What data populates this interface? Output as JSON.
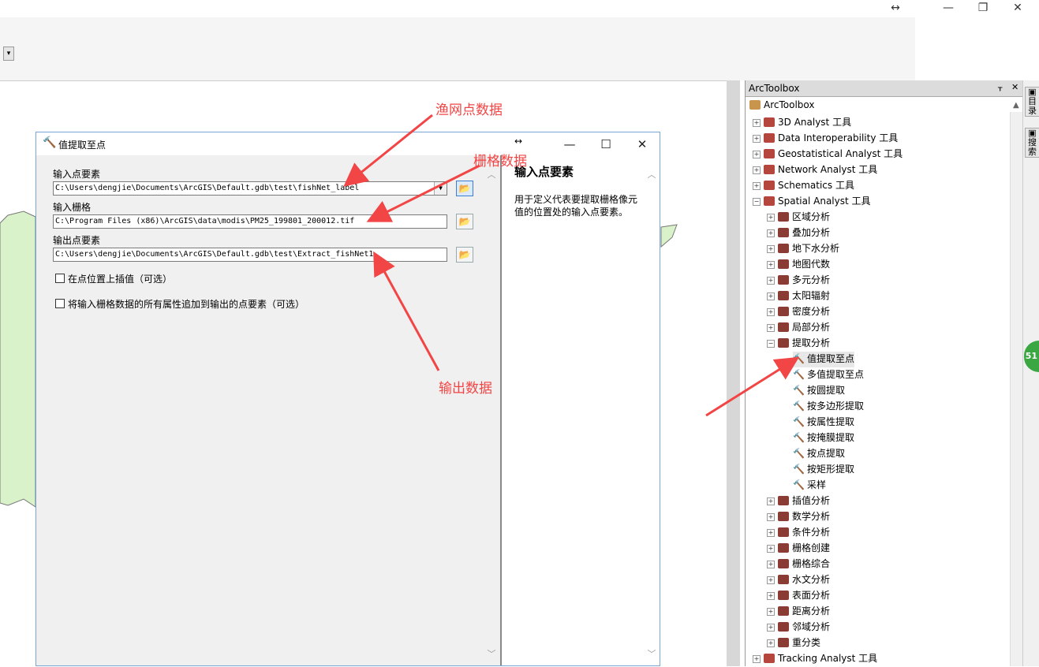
{
  "window": {
    "resize_icon": "↔",
    "minimize_icon": "—",
    "restore_icon": "❐",
    "close_icon": "✕"
  },
  "dialog": {
    "title": "值提取至点",
    "resize_icon": "↔",
    "minimize": "—",
    "maximize": "☐",
    "close": "✕",
    "fields": [
      {
        "label": "输入点要素",
        "value": "C:\\Users\\dengjie\\Documents\\ArcGIS\\Default.gdb\\test\\fishNet_label"
      },
      {
        "label": "输入栅格",
        "value": "C:\\Program Files (x86)\\ArcGIS\\data\\modis\\PM25_199801_200012.tif"
      },
      {
        "label": "输出点要素",
        "value": "C:\\Users\\dengjie\\Documents\\ArcGIS\\Default.gdb\\test\\Extract_fishNet1"
      }
    ],
    "checkboxes": [
      {
        "label": "在点位置上插值（可选）",
        "checked": false
      },
      {
        "label": "将输入栅格数据的所有属性追加到输出的点要素（可选）",
        "checked": false
      }
    ],
    "help": {
      "title": "输入点要素",
      "text": "用于定义代表要提取栅格像元值的位置处的输入点要素。"
    }
  },
  "annotations": {
    "fishnet": "渔网点数据",
    "raster": "栅格数据",
    "output": "输出数据",
    "color": "#f24545"
  },
  "toolbox": {
    "header": "ArcToolbox",
    "pin": "ᚁ",
    "close": "✕",
    "root": "ArcToolbox",
    "items": [
      {
        "label": "3D Analyst 工具",
        "level": 1,
        "type": "box",
        "pm": "+"
      },
      {
        "label": "Data Interoperability 工具",
        "level": 1,
        "type": "box",
        "pm": "+"
      },
      {
        "label": "Geostatistical Analyst 工具",
        "level": 1,
        "type": "box",
        "pm": "+"
      },
      {
        "label": "Network Analyst 工具",
        "level": 1,
        "type": "box",
        "pm": "+"
      },
      {
        "label": "Schematics 工具",
        "level": 1,
        "type": "box",
        "pm": "+"
      },
      {
        "label": "Spatial Analyst 工具",
        "level": 1,
        "type": "box",
        "pm": "−"
      },
      {
        "label": "区域分析",
        "level": 2,
        "type": "set",
        "pm": "+"
      },
      {
        "label": "叠加分析",
        "level": 2,
        "type": "set",
        "pm": "+"
      },
      {
        "label": "地下水分析",
        "level": 2,
        "type": "set",
        "pm": "+"
      },
      {
        "label": "地图代数",
        "level": 2,
        "type": "set",
        "pm": "+"
      },
      {
        "label": "多元分析",
        "level": 2,
        "type": "set",
        "pm": "+"
      },
      {
        "label": "太阳辐射",
        "level": 2,
        "type": "set",
        "pm": "+"
      },
      {
        "label": "密度分析",
        "level": 2,
        "type": "set",
        "pm": "+"
      },
      {
        "label": "局部分析",
        "level": 2,
        "type": "set",
        "pm": "+"
      },
      {
        "label": "提取分析",
        "level": 2,
        "type": "set",
        "pm": "−"
      },
      {
        "label": "值提取至点",
        "level": 3,
        "type": "tool",
        "selected": true
      },
      {
        "label": "多值提取至点",
        "level": 3,
        "type": "tool"
      },
      {
        "label": "按圆提取",
        "level": 3,
        "type": "tool"
      },
      {
        "label": "按多边形提取",
        "level": 3,
        "type": "tool"
      },
      {
        "label": "按属性提取",
        "level": 3,
        "type": "tool"
      },
      {
        "label": "按掩膜提取",
        "level": 3,
        "type": "tool"
      },
      {
        "label": "按点提取",
        "level": 3,
        "type": "tool"
      },
      {
        "label": "按矩形提取",
        "level": 3,
        "type": "tool"
      },
      {
        "label": "采样",
        "level": 3,
        "type": "tool"
      },
      {
        "label": "插值分析",
        "level": 2,
        "type": "set",
        "pm": "+"
      },
      {
        "label": "数学分析",
        "level": 2,
        "type": "set",
        "pm": "+"
      },
      {
        "label": "条件分析",
        "level": 2,
        "type": "set",
        "pm": "+"
      },
      {
        "label": "栅格创建",
        "level": 2,
        "type": "set",
        "pm": "+"
      },
      {
        "label": "栅格综合",
        "level": 2,
        "type": "set",
        "pm": "+"
      },
      {
        "label": "水文分析",
        "level": 2,
        "type": "set",
        "pm": "+"
      },
      {
        "label": "表面分析",
        "level": 2,
        "type": "set",
        "pm": "+"
      },
      {
        "label": "距离分析",
        "level": 2,
        "type": "set",
        "pm": "+"
      },
      {
        "label": "邻域分析",
        "level": 2,
        "type": "set",
        "pm": "+"
      },
      {
        "label": "重分类",
        "level": 2,
        "type": "set",
        "pm": "+"
      },
      {
        "label": "Tracking Analyst 工具",
        "level": 1,
        "type": "box",
        "pm": "+"
      }
    ]
  },
  "sidetabs": {
    "catalog": "目录",
    "search": "搜索"
  },
  "badge": "51"
}
